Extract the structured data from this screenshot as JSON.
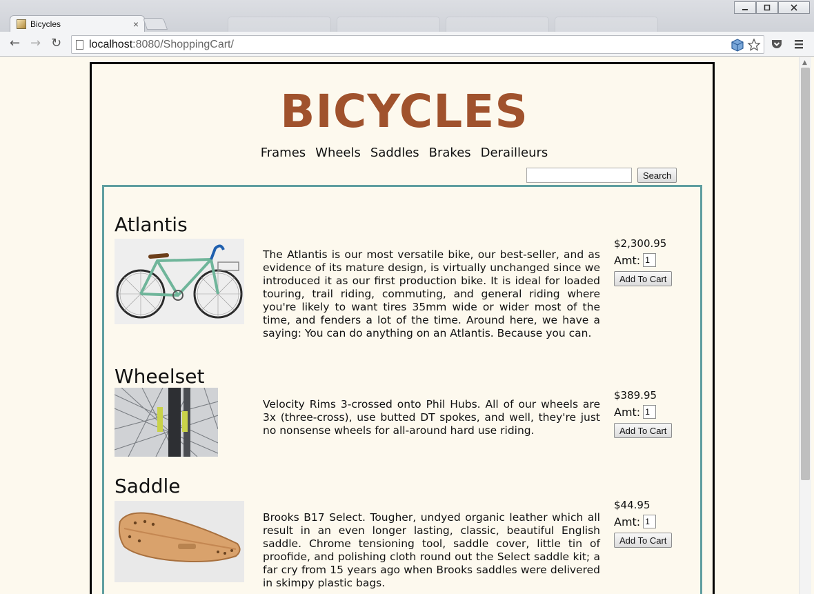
{
  "browser": {
    "tab_title": "Bicycles",
    "tab_close": "×",
    "url_host": "localhost",
    "url_path": ":8080/ShoppingCart/",
    "window_controls": [
      "minimize",
      "restore",
      "close"
    ]
  },
  "site": {
    "logo": "BICYCLES",
    "logo_color": "#a0522d",
    "nav": [
      "Frames",
      "Wheels",
      "Saddles",
      "Brakes",
      "Derailleurs"
    ],
    "search": {
      "value": "",
      "button": "Search"
    }
  },
  "products": [
    {
      "name": "Atlantis",
      "image": "green-touring-bicycle",
      "description": "The Atlantis is our most versatile bike, our best-seller, and as evidence of its mature design, is virtually unchanged since we introduced it as our first production bike. It is ideal for loaded touring, trail riding, commuting, and general riding where you're likely to want tires 35mm wide or wider most of the time, and fenders a lot of the time. Around here, we have a saying: You can do anything on an Atlantis. Because you can.",
      "price": "$2,300.95",
      "amt_label": "Amt:",
      "amt_value": "1",
      "button": "Add To Cart"
    },
    {
      "name": "Wheelset",
      "image": "wheel-spokes-closeup",
      "description": "Velocity Rims 3-crossed onto Phil Hubs. All of our wheels are 3x (three-cross), use butted DT spokes, and well, they're just no nonsense wheels for all-around hard use riding.",
      "price": "$389.95",
      "amt_label": "Amt:",
      "amt_value": "1",
      "button": "Add To Cart"
    },
    {
      "name": "Saddle",
      "image": "leather-saddle",
      "description": "Brooks B17 Select. Tougher, undyed organic leather which all result in an even longer lasting, classic, beautiful English saddle. Chrome tensioning tool, saddle cover, little tin of proofide, and polishing cloth round out the Select saddle kit; a far cry from 15 years ago when Brooks saddles were delivered in skimpy plastic bags.",
      "price": "$44.95",
      "amt_label": "Amt:",
      "amt_value": "1",
      "button": "Add To Cart"
    }
  ]
}
